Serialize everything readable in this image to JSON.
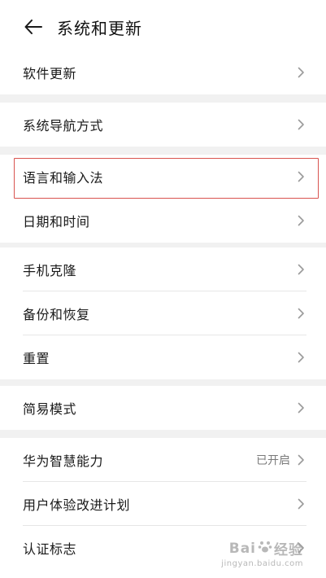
{
  "header": {
    "title": "系统和更新",
    "back_icon": "arrow-left-icon"
  },
  "groups": [
    {
      "items": [
        {
          "label": "软件更新"
        }
      ]
    },
    {
      "items": [
        {
          "label": "系统导航方式"
        }
      ]
    },
    {
      "items": [
        {
          "label": "语言和输入法"
        },
        {
          "label": "日期和时间"
        }
      ]
    },
    {
      "items": [
        {
          "label": "手机克隆"
        },
        {
          "label": "备份和恢复"
        },
        {
          "label": "重置"
        }
      ]
    },
    {
      "items": [
        {
          "label": "简易模式"
        }
      ]
    },
    {
      "items": [
        {
          "label": "华为智慧能力",
          "value": "已开启"
        },
        {
          "label": "用户体验改进计划"
        },
        {
          "label": "认证标志"
        }
      ]
    }
  ],
  "highlight": {
    "target": "语言和输入法",
    "color": "#d9534f"
  },
  "watermark": {
    "main_left": "Bai",
    "main_right": "经验",
    "sub": "jingyan.baidu.com"
  },
  "colors": {
    "background": "#ffffff",
    "separator": "#f1f1f1",
    "divider": "#e6e6e6",
    "text": "#1a1a1a",
    "secondary": "#7a7a7a"
  }
}
